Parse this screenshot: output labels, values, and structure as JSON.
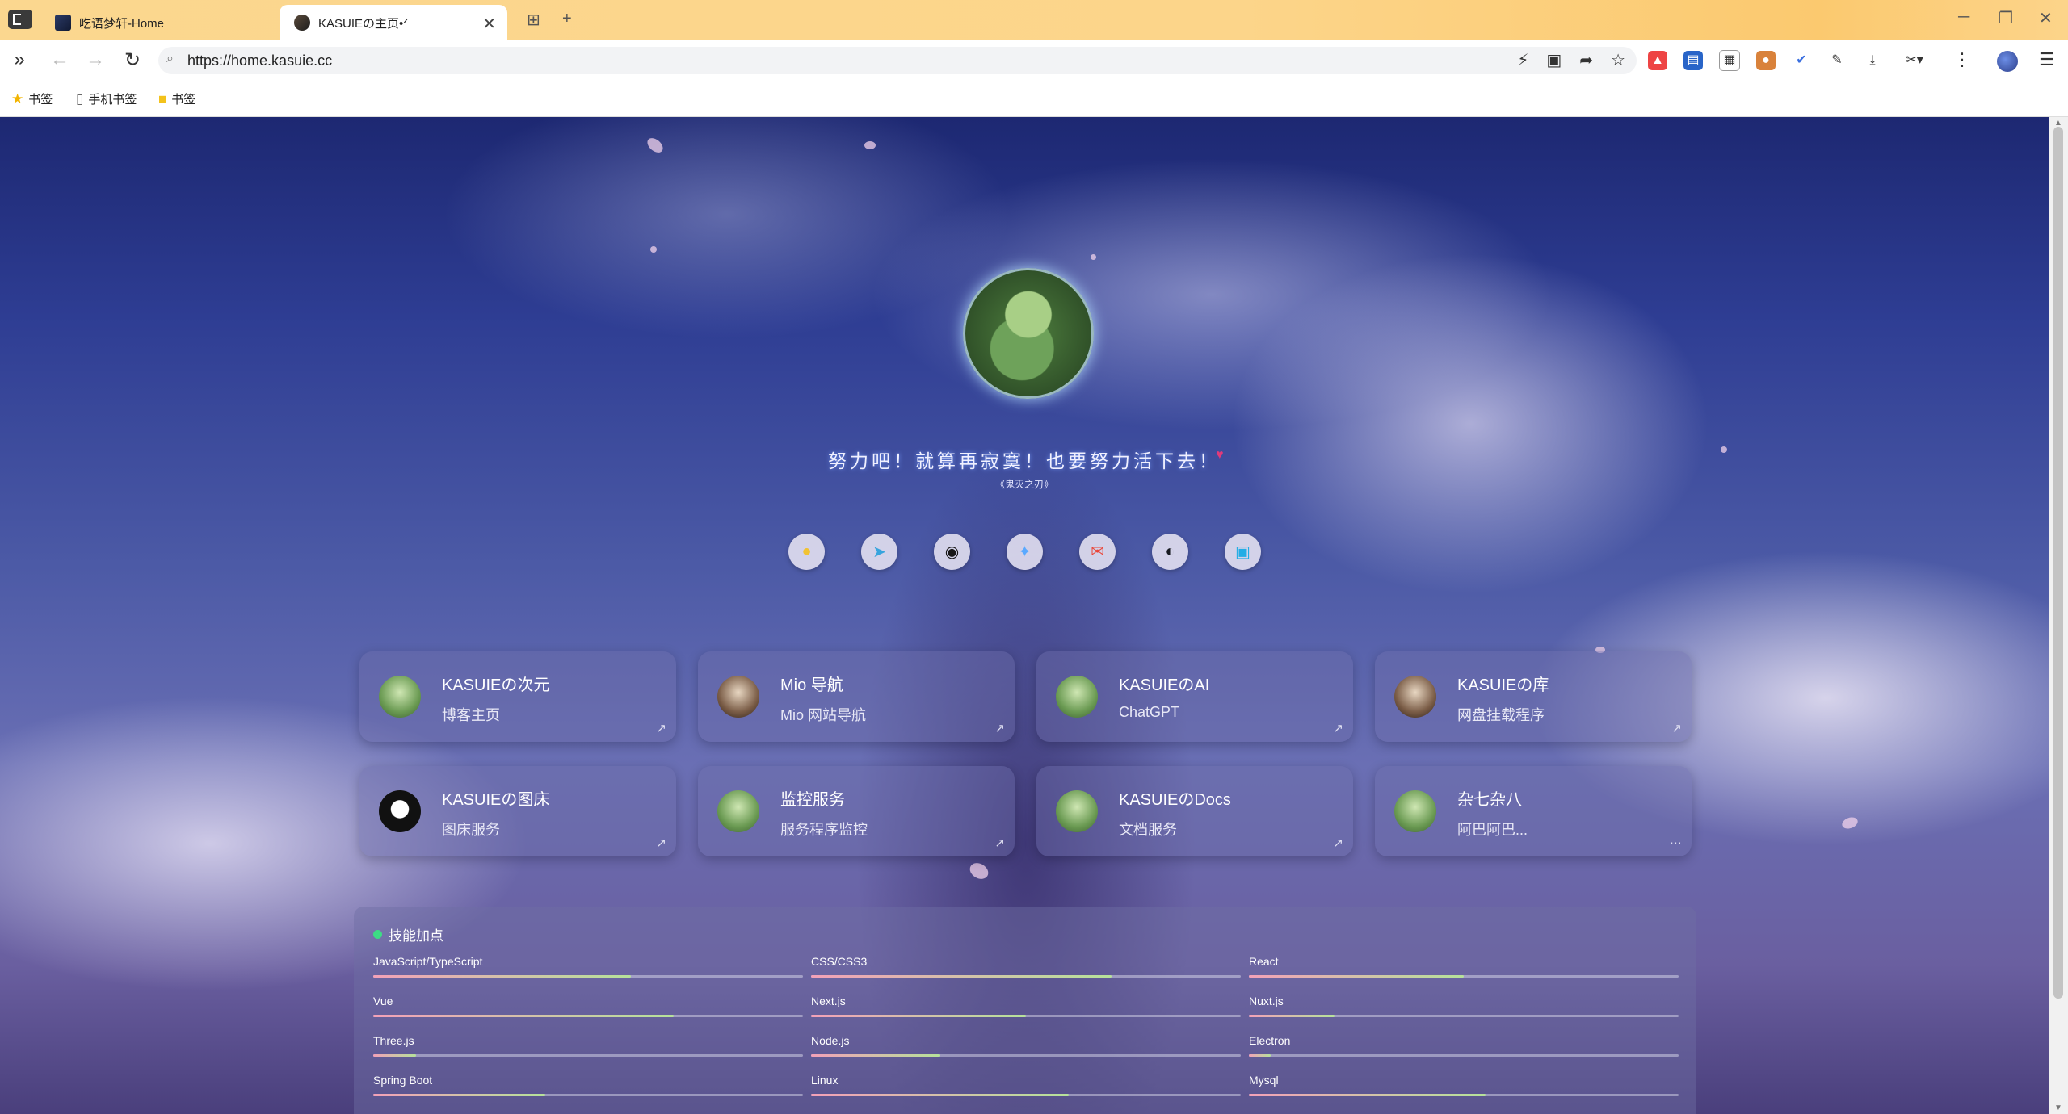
{
  "browser": {
    "tabs": [
      {
        "title": "吃语梦轩-Home",
        "active": false
      },
      {
        "title": "KASUIEの主页•ᐟ",
        "active": true
      }
    ],
    "new_tab": "+",
    "url": "https://home.kasuie.cc",
    "bookmarks": [
      "书签",
      "手机书签",
      "书签"
    ],
    "window_controls": [
      "─",
      "❐",
      "✕"
    ]
  },
  "hero": {
    "motto": "努力吧！就算再寂寞！也要努力活下去！",
    "source": "《鬼灭之刃》"
  },
  "socials": [
    {
      "icon": "qq-icon",
      "color": "#f1c232"
    },
    {
      "icon": "telegram-icon",
      "color": "#37a4dd"
    },
    {
      "icon": "github-icon",
      "color": "#181717"
    },
    {
      "icon": "twitter-icon",
      "color": "#5aa9ff"
    },
    {
      "icon": "email-icon",
      "color": "#ea4335"
    },
    {
      "icon": "steam-icon",
      "color": "#171a21"
    },
    {
      "icon": "bilibili-icon",
      "color": "#23ade5"
    }
  ],
  "cards": [
    {
      "title": "KASUIEの次元",
      "subtitle": "博客主页",
      "icon": "external-link-icon"
    },
    {
      "title": "Mio 导航",
      "subtitle": "Mio 网站导航",
      "icon": "external-link-icon"
    },
    {
      "title": "KASUIEのAI",
      "subtitle": "ChatGPT",
      "icon": "external-link-icon"
    },
    {
      "title": "KASUIEの库",
      "subtitle": "网盘挂载程序",
      "icon": "external-link-icon"
    },
    {
      "title": "KASUIEの图床",
      "subtitle": "图床服务",
      "icon": "external-link-icon"
    },
    {
      "title": "监控服务",
      "subtitle": "服务程序监控",
      "icon": "external-link-icon"
    },
    {
      "title": "KASUIEのDocs",
      "subtitle": "文档服务",
      "icon": "external-link-icon"
    },
    {
      "title": "杂七杂八",
      "subtitle": "阿巴阿巴...",
      "icon": "more-icon"
    }
  ],
  "skills": {
    "title": "技能加点",
    "items": [
      {
        "name": "JavaScript/TypeScript",
        "level": 0.6
      },
      {
        "name": "CSS/CSS3",
        "level": 0.7
      },
      {
        "name": "React",
        "level": 0.5
      },
      {
        "name": "Vue",
        "level": 0.7
      },
      {
        "name": "Next.js",
        "level": 0.5
      },
      {
        "name": "Nuxt.js",
        "level": 0.2
      },
      {
        "name": "Three.js",
        "level": 0.1
      },
      {
        "name": "Node.js",
        "level": 0.3
      },
      {
        "name": "Electron",
        "level": 0.05
      },
      {
        "name": "Spring Boot",
        "level": 0.4
      },
      {
        "name": "Linux",
        "level": 0.6
      },
      {
        "name": "Mysql",
        "level": 0.55
      }
    ]
  }
}
